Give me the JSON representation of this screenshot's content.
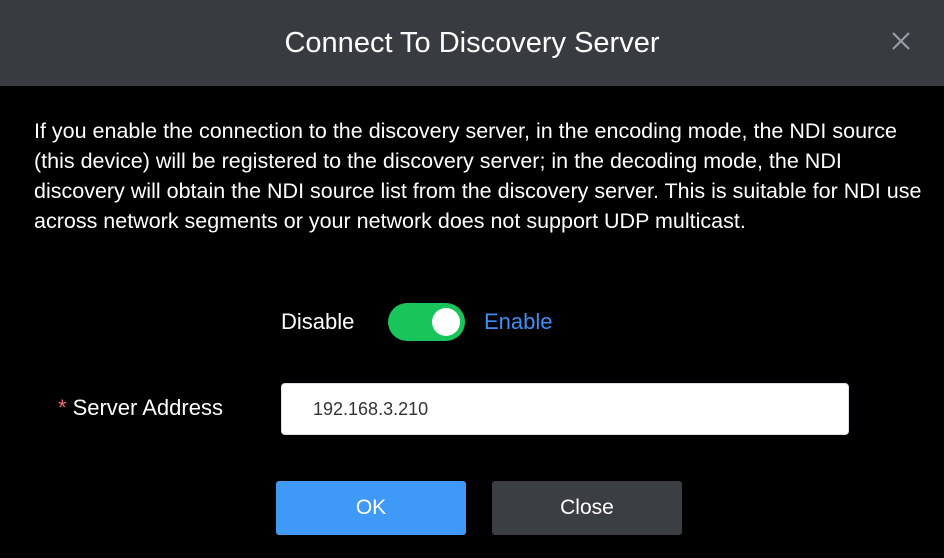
{
  "dialog": {
    "title": "Connect To Discovery Server",
    "close_icon": "close-icon",
    "description": "If you enable the connection to the discovery server, in the encoding mode, the NDI source (this device) will be registered to the discovery server; in the decoding mode, the NDI discovery will obtain the NDI source list from the discovery server. This is suitable for NDI use across network segments or your network does not support UDP multicast."
  },
  "toggle": {
    "off_label": "Disable",
    "on_label": "Enable",
    "state": "on"
  },
  "server_address": {
    "required_mark": "*",
    "label": "Server Address",
    "value": "192.168.3.210"
  },
  "buttons": {
    "ok_label": "OK",
    "close_label": "Close"
  },
  "colors": {
    "header_bg": "#383b40",
    "body_bg": "#000000",
    "switch_on": "#19c45a",
    "enable_text": "#3b8ff5",
    "ok_button": "#3f99f7",
    "close_button": "#3b3e42",
    "required_mark": "#f56c6c"
  }
}
